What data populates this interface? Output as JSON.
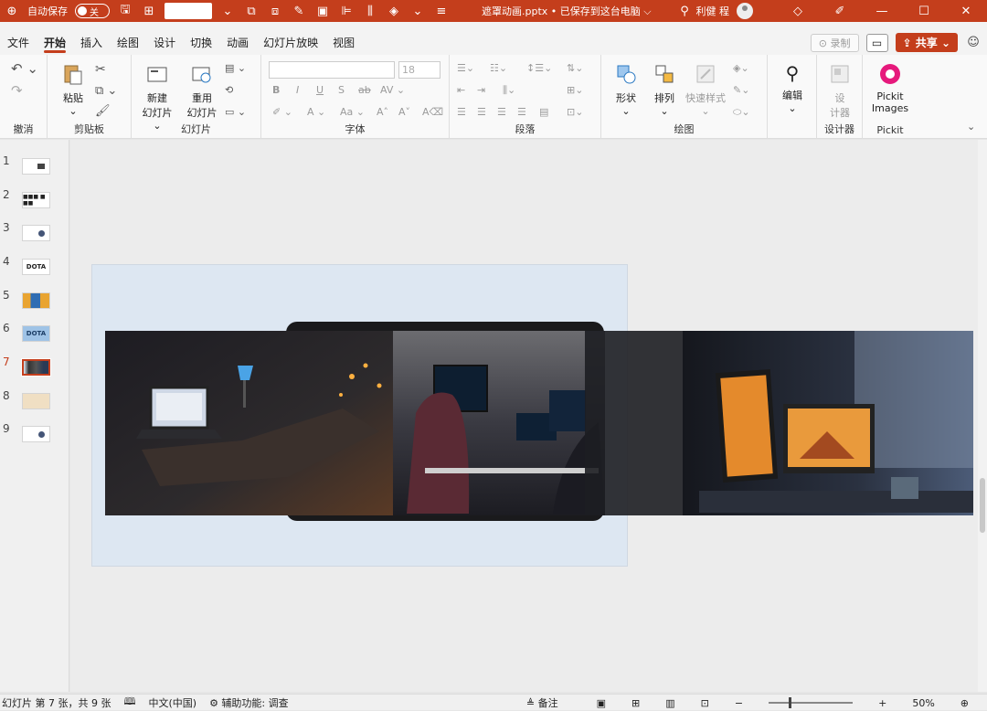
{
  "titlebar": {
    "autosave_label": "自动保存",
    "autosave_state": "关",
    "doc_title": "遮罩动画.pptx • 已保存到这台电脑 ⌵",
    "user_name": "利健 程",
    "accent_color": "#c43e1c"
  },
  "tabs": [
    "文件",
    "开始",
    "插入",
    "绘图",
    "设计",
    "切换",
    "动画",
    "幻灯片放映",
    "视图"
  ],
  "tabs_right": {
    "record": "录制",
    "share": "共享"
  },
  "ribbon": {
    "undo": {
      "group": "撤消"
    },
    "clipboard": {
      "paste": "粘贴",
      "group": "剪贴板"
    },
    "slides": {
      "new_slide_1": "新建",
      "new_slide_2": "幻灯片 ⌄",
      "reuse_1": "重用",
      "reuse_2": "幻灯片",
      "group": "幻灯片"
    },
    "font": {
      "size": "18",
      "group": "字体"
    },
    "paragraph": {
      "group": "段落"
    },
    "drawing": {
      "shape": "形状",
      "arrange": "排列",
      "quick_style": "快速样式",
      "group": "绘图"
    },
    "editing": {
      "edit": "编辑"
    },
    "designer": {
      "label_1": "设",
      "label_2": "计器",
      "group": "设计器"
    },
    "pickit": {
      "label_1": "Pickit",
      "label_2": "Images",
      "group": "Pickit"
    }
  },
  "slides": [
    {
      "num": "1",
      "thumb": ""
    },
    {
      "num": "2",
      "thumb": "■■■ ■ ■■"
    },
    {
      "num": "3",
      "thumb": ""
    },
    {
      "num": "4",
      "thumb": "DOTA"
    },
    {
      "num": "5",
      "thumb": ""
    },
    {
      "num": "6",
      "thumb": "DOTA"
    },
    {
      "num": "7",
      "thumb": ""
    },
    {
      "num": "8",
      "thumb": ""
    },
    {
      "num": "9",
      "thumb": ""
    }
  ],
  "status": {
    "slide_info": "幻灯片 第 7 张，共 9 张",
    "language": "中文(中国)",
    "accessibility": "辅助功能: 调查",
    "notes": "备注",
    "zoom": "50%"
  }
}
